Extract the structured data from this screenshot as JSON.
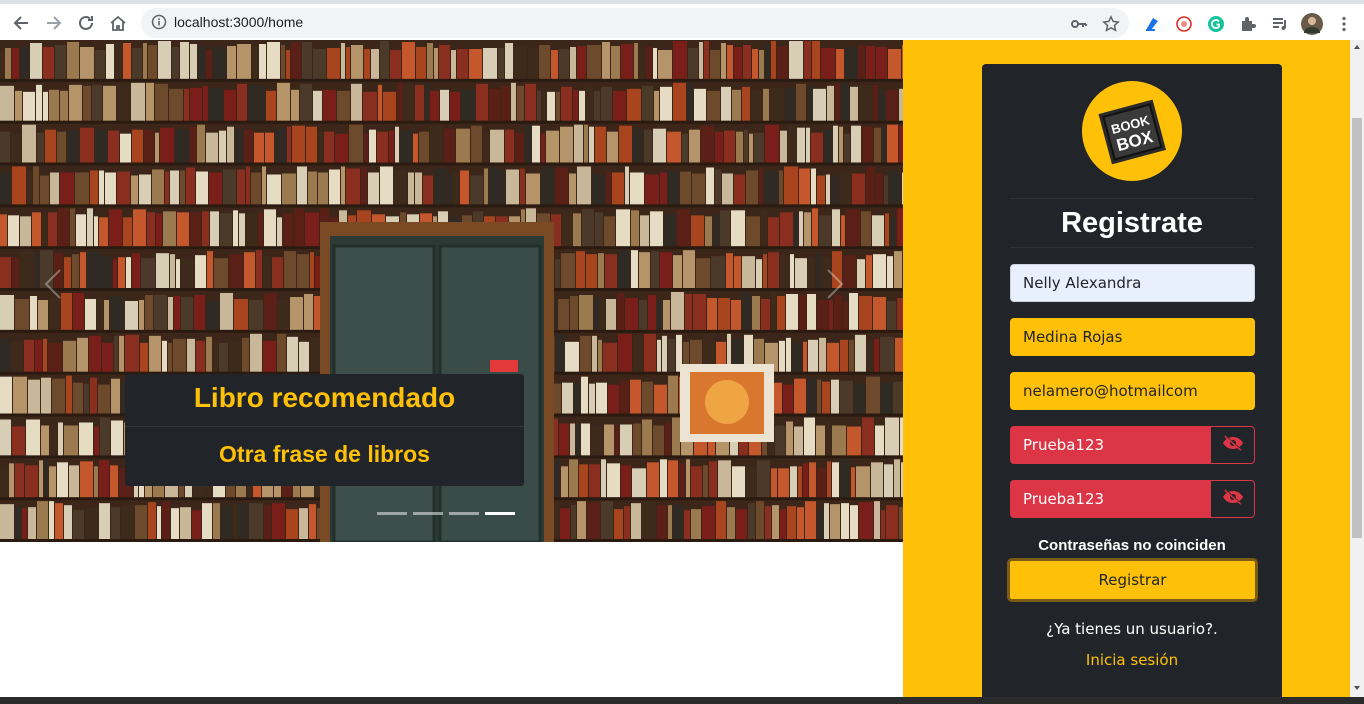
{
  "browser": {
    "url": "localhost:3000/home",
    "icons": [
      "back-icon",
      "forward-icon",
      "reload-icon",
      "home-icon",
      "info-icon",
      "key-icon",
      "star-icon",
      "extension-icon",
      "puzzle-icon",
      "media-icon",
      "profile-avatar",
      "menu-icon"
    ]
  },
  "carousel": {
    "caption_title": "Libro recomendado",
    "caption_subtitle": "Otra frase de libros",
    "slide_count": 4,
    "active_slide": 4
  },
  "register": {
    "logo_text": [
      "BOOK",
      "BOX"
    ],
    "title": "Registrate",
    "first_name": "Nelly Alexandra",
    "last_name": "Medina Rojas",
    "email": "nelamero@hotmailcom",
    "password": "Prueba123",
    "confirm_password": "Prueba123",
    "error": "Contraseñas no coinciden",
    "submit_label": "Registrar",
    "question": "¿Ya tienes un usuario?.",
    "login_link": "Inicia sesión"
  },
  "colors": {
    "accent": "#ffc107",
    "dark": "#212529",
    "danger": "#dc3545",
    "autofill": "#e8f0fe"
  }
}
